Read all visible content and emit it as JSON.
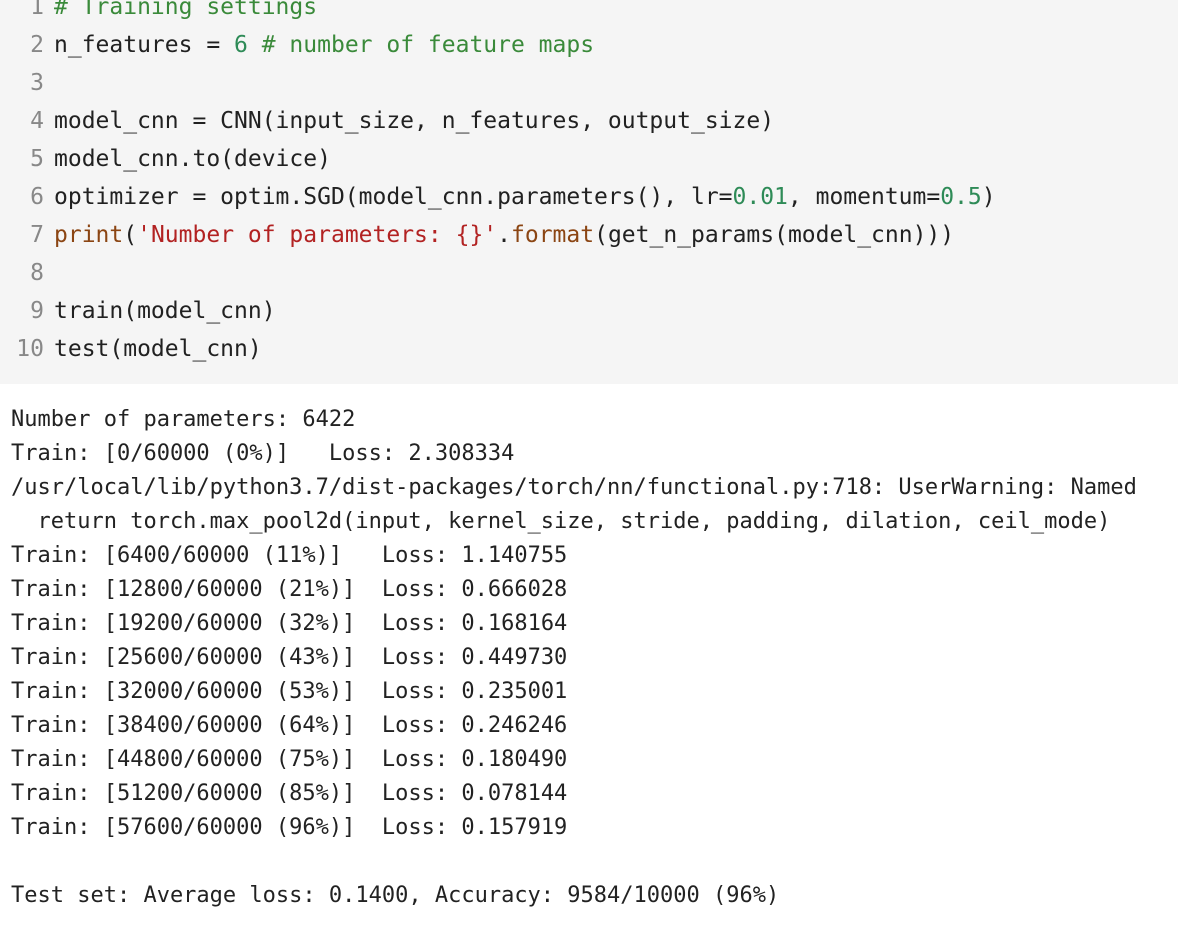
{
  "code_cell": {
    "lines": [
      {
        "n": "1",
        "tokens": [
          {
            "t": "# Training settings",
            "c": "comment"
          }
        ]
      },
      {
        "n": "2",
        "tokens": [
          {
            "t": "n_features = ",
            "c": "plain"
          },
          {
            "t": "6",
            "c": "number"
          },
          {
            "t": " ",
            "c": "plain"
          },
          {
            "t": "# number of feature maps",
            "c": "comment"
          }
        ]
      },
      {
        "n": "3",
        "tokens": []
      },
      {
        "n": "4",
        "tokens": [
          {
            "t": "model_cnn = CNN(input_size, n_features, output_size)",
            "c": "plain"
          }
        ]
      },
      {
        "n": "5",
        "tokens": [
          {
            "t": "model_cnn.to(device)",
            "c": "plain"
          }
        ]
      },
      {
        "n": "6",
        "tokens": [
          {
            "t": "optimizer = optim.SGD(model_cnn.parameters(), lr=",
            "c": "plain"
          },
          {
            "t": "0.01",
            "c": "number"
          },
          {
            "t": ", momentum=",
            "c": "plain"
          },
          {
            "t": "0.5",
            "c": "number"
          },
          {
            "t": ")",
            "c": "plain"
          }
        ]
      },
      {
        "n": "7",
        "tokens": [
          {
            "t": "print",
            "c": "builtin"
          },
          {
            "t": "(",
            "c": "plain"
          },
          {
            "t": "'Number of parameters: {}'",
            "c": "string"
          },
          {
            "t": ".",
            "c": "plain"
          },
          {
            "t": "format",
            "c": "builtin"
          },
          {
            "t": "(get_n_params(model_cnn)))",
            "c": "plain"
          }
        ]
      },
      {
        "n": "8",
        "tokens": []
      },
      {
        "n": "9",
        "tokens": [
          {
            "t": "train(model_cnn)",
            "c": "plain"
          }
        ]
      },
      {
        "n": "10",
        "tokens": [
          {
            "t": "test(model_cnn)",
            "c": "plain"
          }
        ]
      }
    ]
  },
  "output": {
    "lines": [
      "Number of parameters: 6422",
      "Train: [0/60000 (0%)]\tLoss: 2.308334",
      "/usr/local/lib/python3.7/dist-packages/torch/nn/functional.py:718: UserWarning: Named",
      "  return torch.max_pool2d(input, kernel_size, stride, padding, dilation, ceil_mode)",
      "Train: [6400/60000 (11%)]\tLoss: 1.140755",
      "Train: [12800/60000 (21%)]\tLoss: 0.666028",
      "Train: [19200/60000 (32%)]\tLoss: 0.168164",
      "Train: [25600/60000 (43%)]\tLoss: 0.449730",
      "Train: [32000/60000 (53%)]\tLoss: 0.235001",
      "Train: [38400/60000 (64%)]\tLoss: 0.246246",
      "Train: [44800/60000 (75%)]\tLoss: 0.180490",
      "Train: [51200/60000 (85%)]\tLoss: 0.078144",
      "Train: [57600/60000 (96%)]\tLoss: 0.157919",
      "",
      "Test set: Average loss: 0.1400, Accuracy: 9584/10000 (96%)"
    ]
  }
}
